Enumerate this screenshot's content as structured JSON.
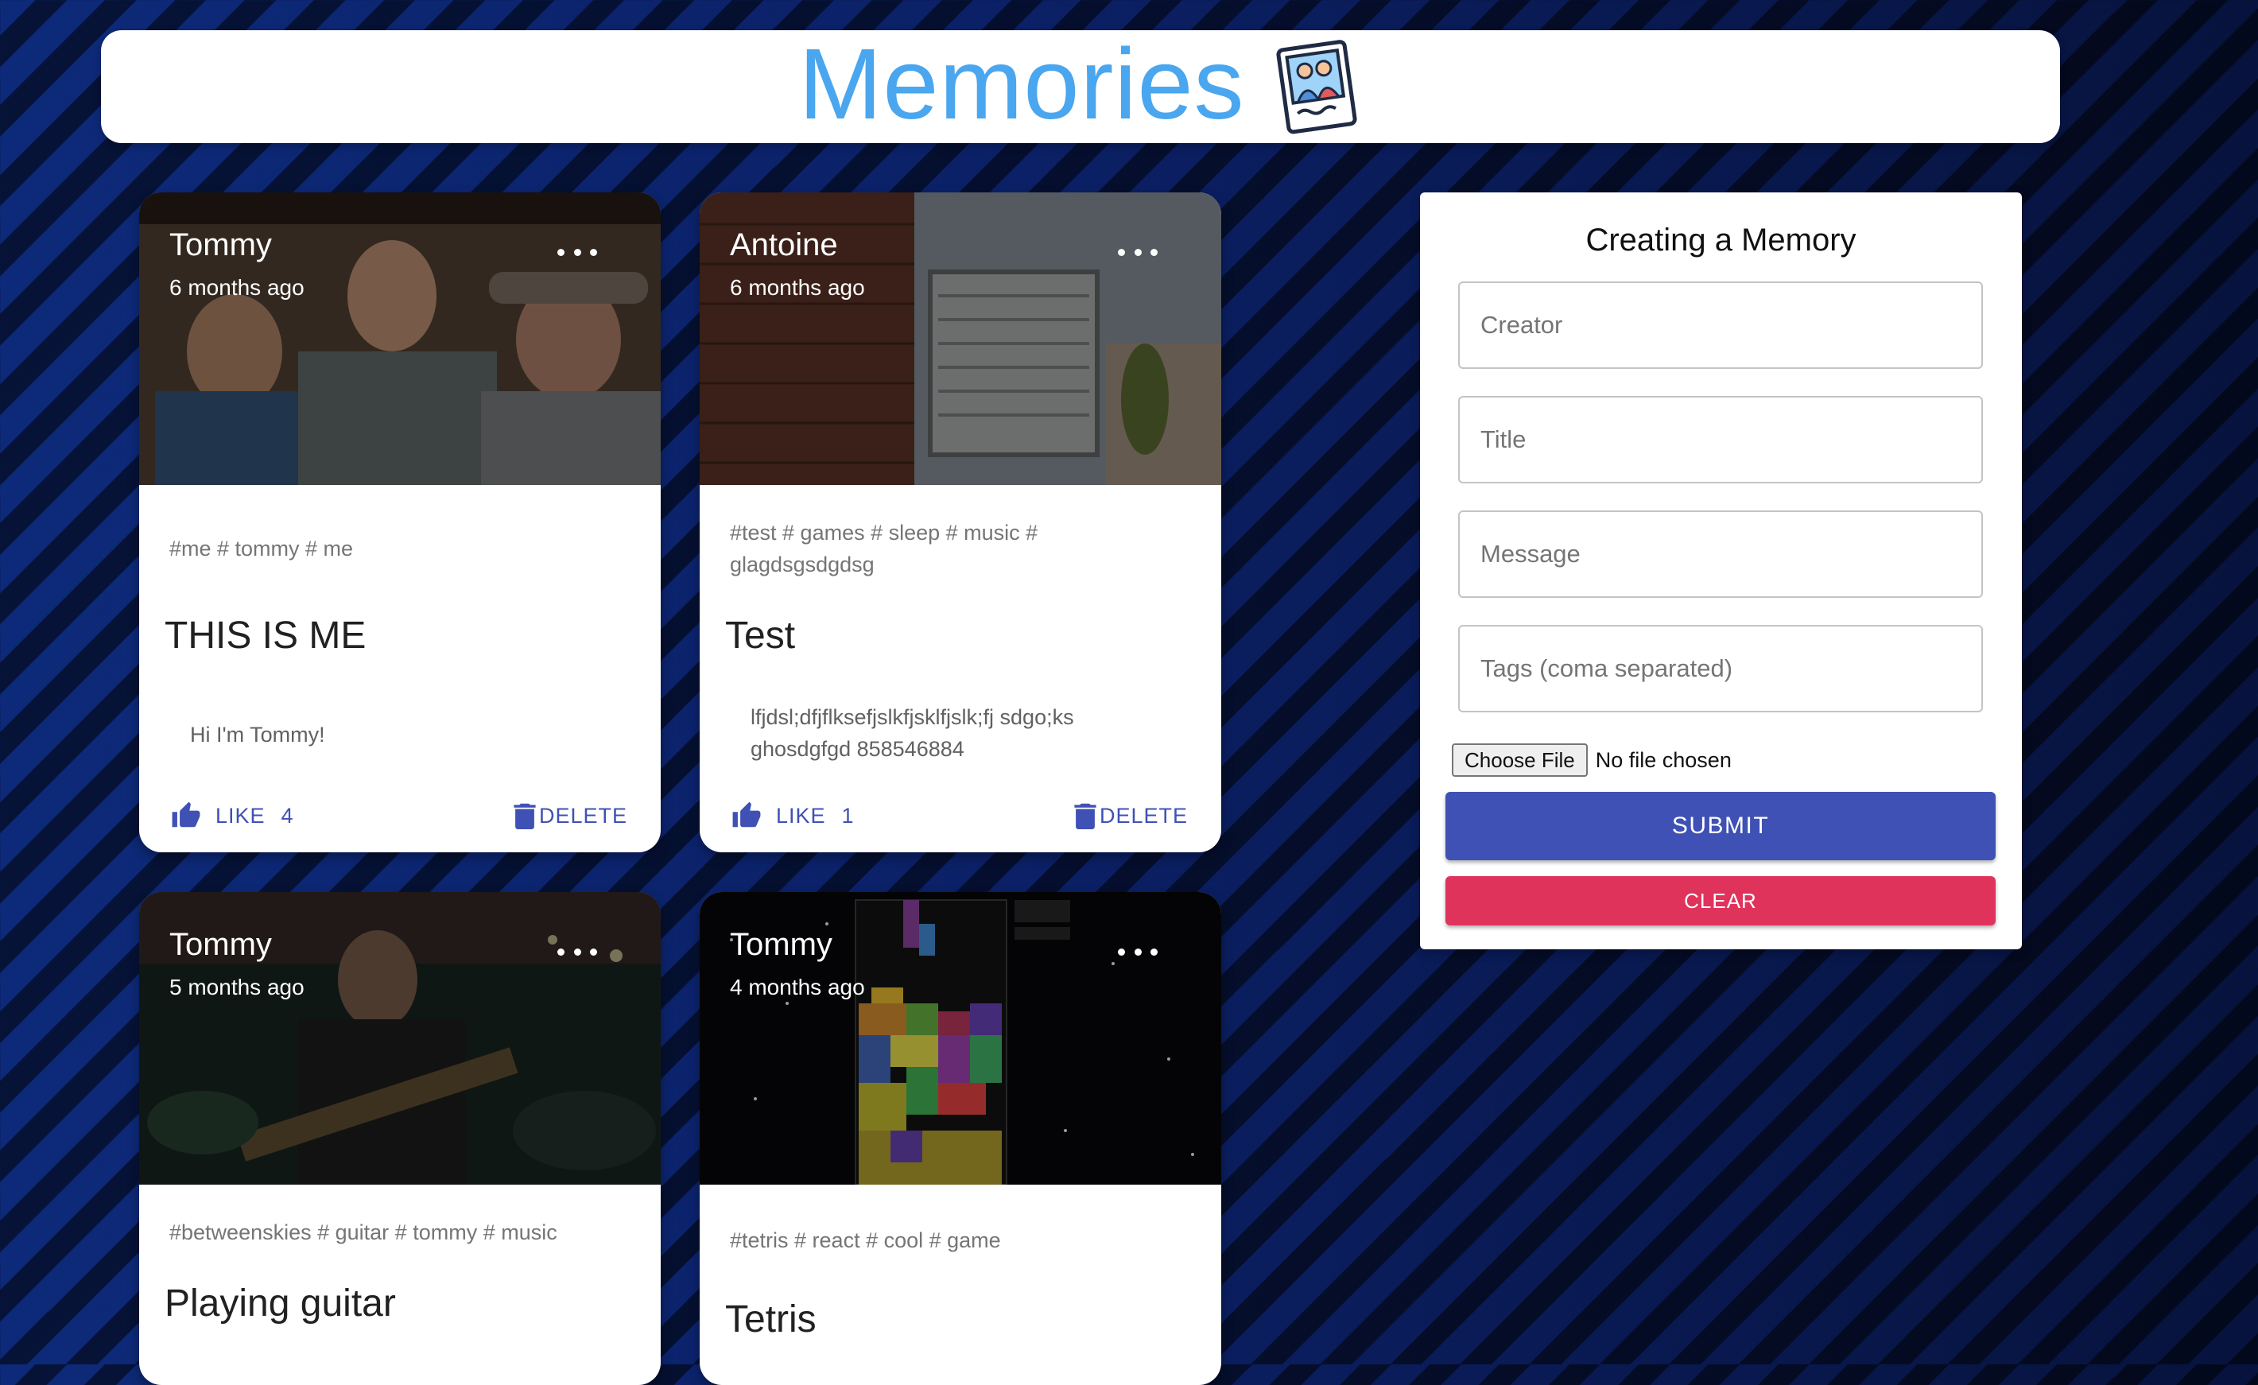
{
  "header": {
    "title": "Memories",
    "logo_icon": "memories-photo-icon"
  },
  "posts": [
    {
      "creator": "Tommy",
      "time": "6 months ago",
      "tags": "#me # tommy # me",
      "title": "THIS IS ME",
      "message": "Hi I'm Tommy!",
      "like_label": "LIKE",
      "like_count": "4",
      "delete_label": "DELETE"
    },
    {
      "creator": "Antoine",
      "time": "6 months ago",
      "tags": "#test # games # sleep # music # glagdsgsdgdsg",
      "title": "Test",
      "message": "lfjdsl;dfjflksefjslkfjsklfjslk;fj sdgo;ksghosdgfgd 858546884",
      "like_label": "LIKE",
      "like_count": "1",
      "delete_label": "DELETE"
    },
    {
      "creator": "Tommy",
      "time": "5 months ago",
      "tags": "#betweenskies # guitar # tommy # music",
      "title": "Playing guitar"
    },
    {
      "creator": "Tommy",
      "time": "4 months ago",
      "tags": "#tetris # react # cool # game",
      "title": "Tetris"
    }
  ],
  "form": {
    "heading": "Creating a Memory",
    "creator_placeholder": "Creator",
    "title_placeholder": "Title",
    "message_placeholder": "Message",
    "tags_placeholder": "Tags (coma separated)",
    "file_button": "Choose File",
    "file_status": "No file chosen",
    "submit_label": "SUBMIT",
    "clear_label": "CLEAR"
  },
  "colors": {
    "primary": "#3f51b5",
    "secondary": "#e0335c",
    "brand_blue": "#4aa6ee"
  },
  "icons": {
    "like": "thumb-up-icon",
    "delete": "trash-icon",
    "more": "more-horizontal-icon"
  }
}
